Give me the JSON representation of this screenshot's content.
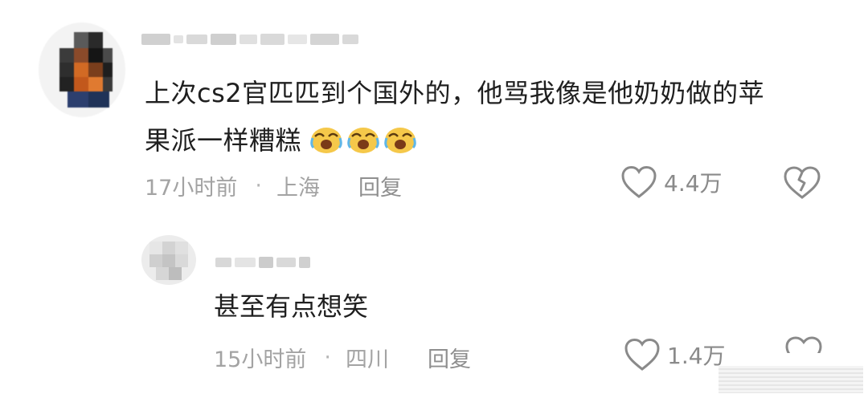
{
  "comment": {
    "text_line1": "上次cs2官匹匹到个国外的，他骂我像是他奶奶做的苹",
    "text_line2": "果派一样糟糕",
    "emoji_names": [
      "laughing-crying-emoji",
      "laughing-crying-emoji",
      "laughing-crying-emoji"
    ],
    "time": "17小时前",
    "separator": "·",
    "location": "上海",
    "reply_label": "回复",
    "likes": "4.4万"
  },
  "reply": {
    "text": "甚至有点想笑",
    "time": "15小时前",
    "separator": "·",
    "location": "四川",
    "reply_label": "回复",
    "likes": "1.4万"
  },
  "icons": {
    "like": "heart-outline-icon",
    "dislike": "broken-heart-icon"
  },
  "colors": {
    "text": "#1f1f1f",
    "meta": "#a3a3a3",
    "icon": "#8a8a8a",
    "emoji_face": "#f5c84a"
  }
}
